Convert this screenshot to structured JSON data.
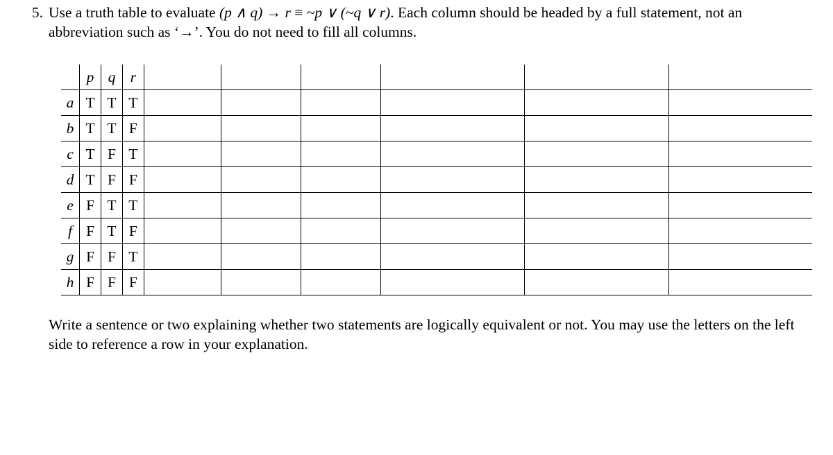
{
  "problem_number": "5.",
  "prompt_pre": "Use a truth table to evaluate ",
  "prompt_expr_left": "(p ∧ q) → r",
  "prompt_equiv": " ≡ ",
  "prompt_expr_right": "~p ∨ (~q ∨ r)",
  "prompt_post1": ". Each column should be headed by a full statement, not an abbreviation such as ‘",
  "prompt_arrow": "→",
  "prompt_post2": "’. You do not need to fill all columns.",
  "headers": {
    "blank": "",
    "p": "p",
    "q": "q",
    "r": "r",
    "c1": "",
    "c2": "",
    "c3": "",
    "c4": "",
    "c5": "",
    "c6": ""
  },
  "rows": [
    {
      "label": "a",
      "p": "T",
      "q": "T",
      "r": "T"
    },
    {
      "label": "b",
      "p": "T",
      "q": "T",
      "r": "F"
    },
    {
      "label": "c",
      "p": "T",
      "q": "F",
      "r": "T"
    },
    {
      "label": "d",
      "p": "T",
      "q": "F",
      "r": "F"
    },
    {
      "label": "e",
      "p": "F",
      "q": "T",
      "r": "T"
    },
    {
      "label": "f",
      "p": "F",
      "q": "T",
      "r": "F"
    },
    {
      "label": "g",
      "p": "F",
      "q": "F",
      "r": "T"
    },
    {
      "label": "h",
      "p": "F",
      "q": "F",
      "r": "F"
    }
  ],
  "followup": "Write a sentence or two explaining whether two statements are logically equivalent or not. You may use the letters on the left side to reference a row in your explanation."
}
